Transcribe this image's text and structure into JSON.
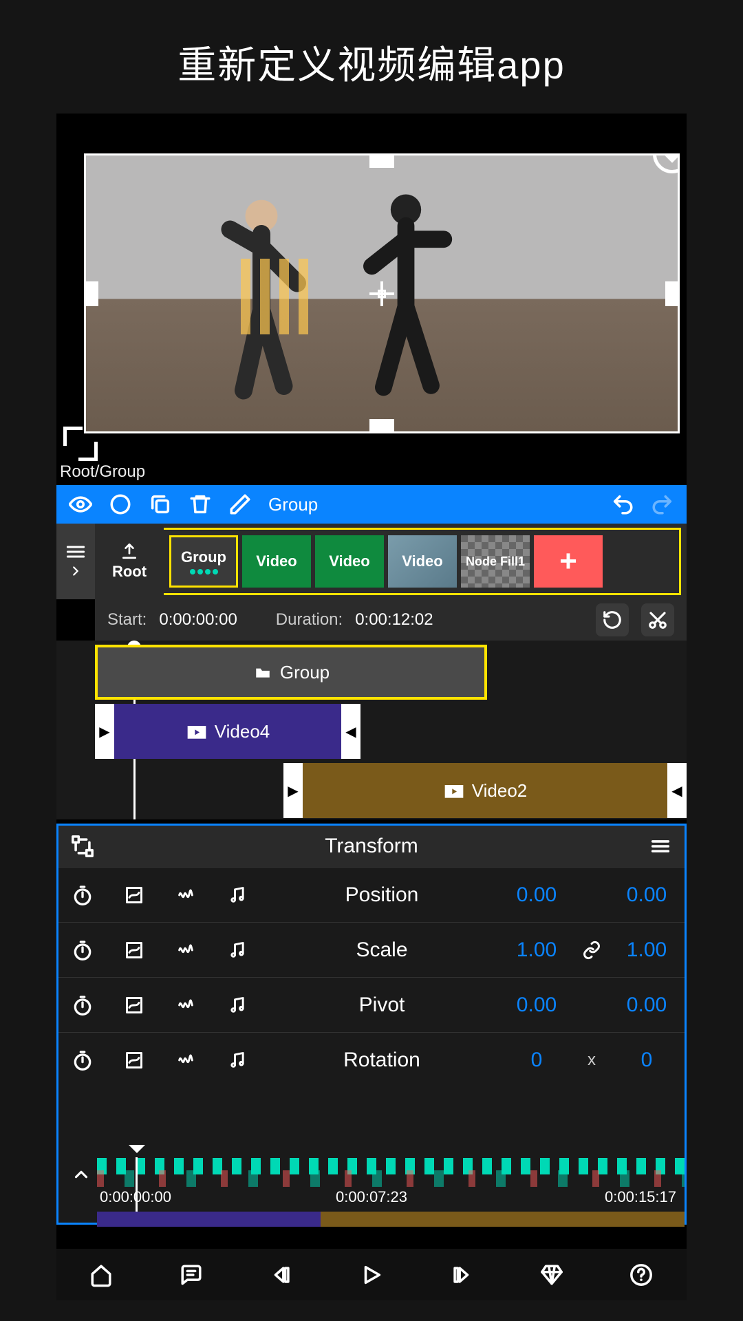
{
  "heading": "重新定义视频编辑app",
  "breadcrumb": "Root/Group",
  "toolbar": {
    "group_label": "Group"
  },
  "nodes": {
    "root": "Root",
    "group": "Group",
    "video1": "Video",
    "video2": "Video",
    "video3": "Video",
    "fill": "Node Fill1",
    "add": "+"
  },
  "duration": {
    "start_label": "Start:",
    "start_value": "0:00:00:00",
    "dur_label": "Duration:",
    "dur_value": "0:00:12:02"
  },
  "tracks": {
    "group": "Group",
    "video4": "Video4",
    "video2": "Video2"
  },
  "transform": {
    "title": "Transform",
    "props": {
      "position": {
        "name": "Position",
        "v1": "0.00",
        "v2": "0.00"
      },
      "scale": {
        "name": "Scale",
        "v1": "1.00",
        "v2": "1.00"
      },
      "pivot": {
        "name": "Pivot",
        "v1": "0.00",
        "v2": "0.00"
      },
      "rotation": {
        "name": "Rotation",
        "v1": "0",
        "mid": "x",
        "v2": "0"
      }
    }
  },
  "ruler": {
    "t1": "0:00:00:00",
    "t2": "0:00:07:23",
    "t3": "0:00:15:17"
  }
}
